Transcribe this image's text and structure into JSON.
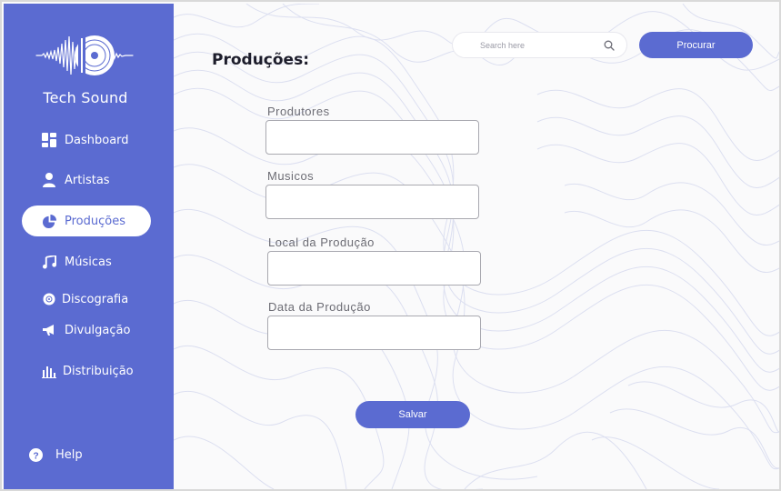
{
  "app": {
    "brand": "Tech Sound",
    "accent_color": "#5b6bd1"
  },
  "sidebar": {
    "items": [
      {
        "label": "Dashboard",
        "icon": "dashboard-icon"
      },
      {
        "label": "Artistas",
        "icon": "person-icon"
      },
      {
        "label": "Produções",
        "icon": "pie-chart-icon",
        "active": true
      },
      {
        "label": "Músicas",
        "icon": "music-note-icon"
      },
      {
        "label": "Discografia",
        "icon": "disc-icon"
      },
      {
        "label": "Divulgação",
        "icon": "megaphone-icon"
      },
      {
        "label": "Distribuição",
        "icon": "bar-chart-icon"
      }
    ],
    "help": {
      "label": "Help",
      "icon": "help-circle-icon"
    }
  },
  "header": {
    "search_placeholder": "Search here",
    "search_value": "",
    "search_button": "Procurar"
  },
  "main": {
    "title": "Produções:",
    "fields": [
      {
        "label": "Produtores",
        "value": ""
      },
      {
        "label": "Musicos",
        "value": ""
      },
      {
        "label": "Local da Produção",
        "value": ""
      },
      {
        "label": "Data da Produção",
        "value": ""
      }
    ],
    "save_button": "Salvar"
  }
}
